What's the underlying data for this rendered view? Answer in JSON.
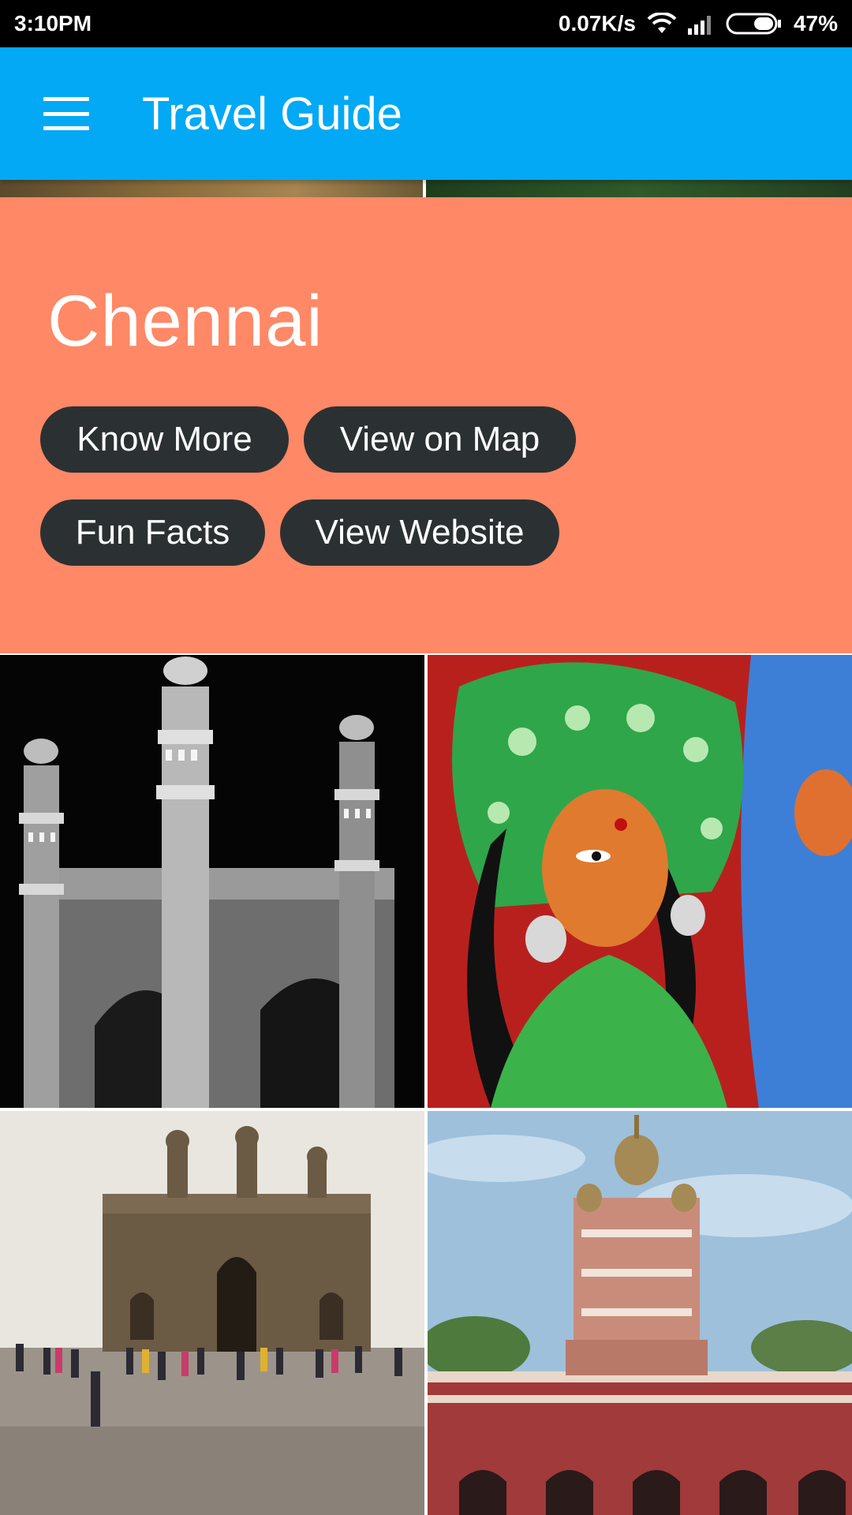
{
  "status_bar": {
    "time": "3:10PM",
    "network_speed": "0.07K/s",
    "battery": "47%",
    "icons": [
      "wifi-icon",
      "signal-icon",
      "battery-icon"
    ]
  },
  "app_bar": {
    "title": "Travel Guide",
    "menu_icon": "menu-icon",
    "background": "#03a9f4"
  },
  "card": {
    "city": "Chennai",
    "background": "#ff8866",
    "buttons": {
      "know_more": "Know More",
      "view_on_map": "View on Map",
      "fun_facts": "Fun Facts",
      "view_website": "View Website"
    },
    "button_color": "#2b3133"
  },
  "gallery": {
    "images": [
      "charminar-photo",
      "durga-idol-photo",
      "gateway-of-india-photo",
      "parvati-temple-photo"
    ]
  }
}
